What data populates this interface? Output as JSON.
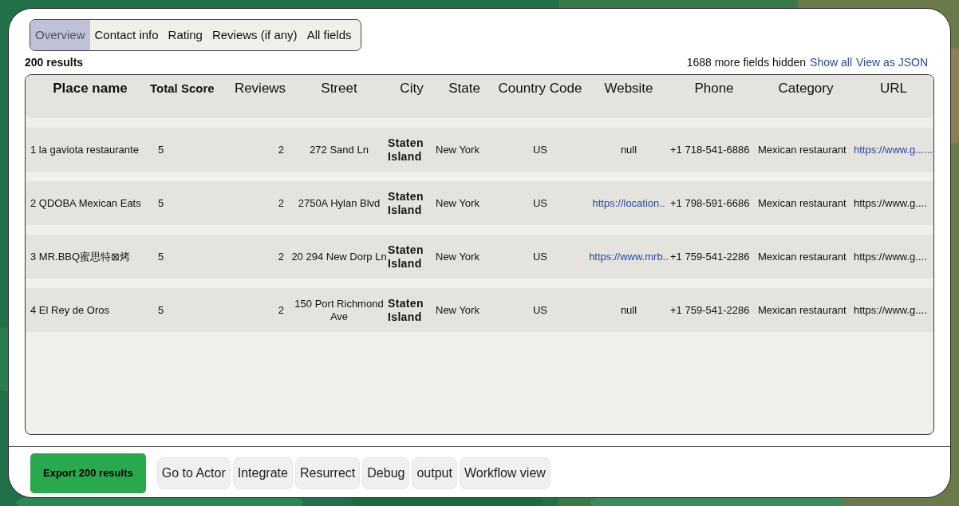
{
  "tabs": [
    {
      "label": "Overview",
      "selected": true
    },
    {
      "label": "Contact info",
      "selected": false
    },
    {
      "label": "Rating",
      "selected": false
    },
    {
      "label": "Reviews (if any)",
      "selected": false
    },
    {
      "label": "All fields",
      "selected": false
    }
  ],
  "results_count": "200 results",
  "hidden_fields": "1688 more fields hidden",
  "links": [
    "Show all",
    "View as JSON"
  ],
  "table": {
    "columns": [
      "Place name",
      "Total Score",
      "Reviews",
      "Street",
      "City",
      "State",
      "Country Code",
      "Website",
      "Phone",
      "Category",
      "URL"
    ],
    "rows": [
      {
        "place": "1 la gaviota restaurante",
        "score": "5",
        "reviews": "2",
        "street": "272 Sand Ln",
        "city": "Staten Island",
        "state": "New York",
        "country": "US",
        "website": {
          "text": "null",
          "link": false
        },
        "phone": "+1 718-541-6886",
        "category": "Mexican restaurant",
        "url": {
          "text": "https://www.g......",
          "link": true
        }
      },
      {
        "place": "2 QDOBA Mexican Eats",
        "score": "5",
        "reviews": "2",
        "street": "2750A Hylan Blvd",
        "city": "Staten Island",
        "state": "New York",
        "country": "US",
        "website": {
          "text": "https://location..",
          "link": true
        },
        "phone": "+1 798-591-6686",
        "category": "Mexican restaurant",
        "url": {
          "text": "https://www.g....",
          "link": false
        }
      },
      {
        "place": "3 MR.BBQ蜜思特⊠烤",
        "score": "5",
        "reviews": "2",
        "street": "20 294 New Dorp Ln",
        "city": "Staten Island",
        "state": "New York",
        "country": "US",
        "website": {
          "text": "https://www.mrb..",
          "link": true
        },
        "phone": "+1 759-541-2286",
        "category": "Mexican restaurant",
        "url": {
          "text": "https://www.g....",
          "link": false
        }
      },
      {
        "place": "4 El Rey de Oros",
        "score": "5",
        "reviews": "2",
        "street": "150 Port Richmond Ave",
        "city": "Staten Island",
        "state": "New York",
        "country": "US",
        "website": {
          "text": "null",
          "link": false
        },
        "phone": "+1 759-541-2286",
        "category": "Mexican restaurant",
        "url": {
          "text": "https://www.g....",
          "link": false
        }
      }
    ]
  },
  "export_button": "Export 200 results",
  "actions": [
    "Go to Actor",
    "Integrate",
    "Resurrect",
    "Debug",
    "output",
    "Workflow view"
  ]
}
